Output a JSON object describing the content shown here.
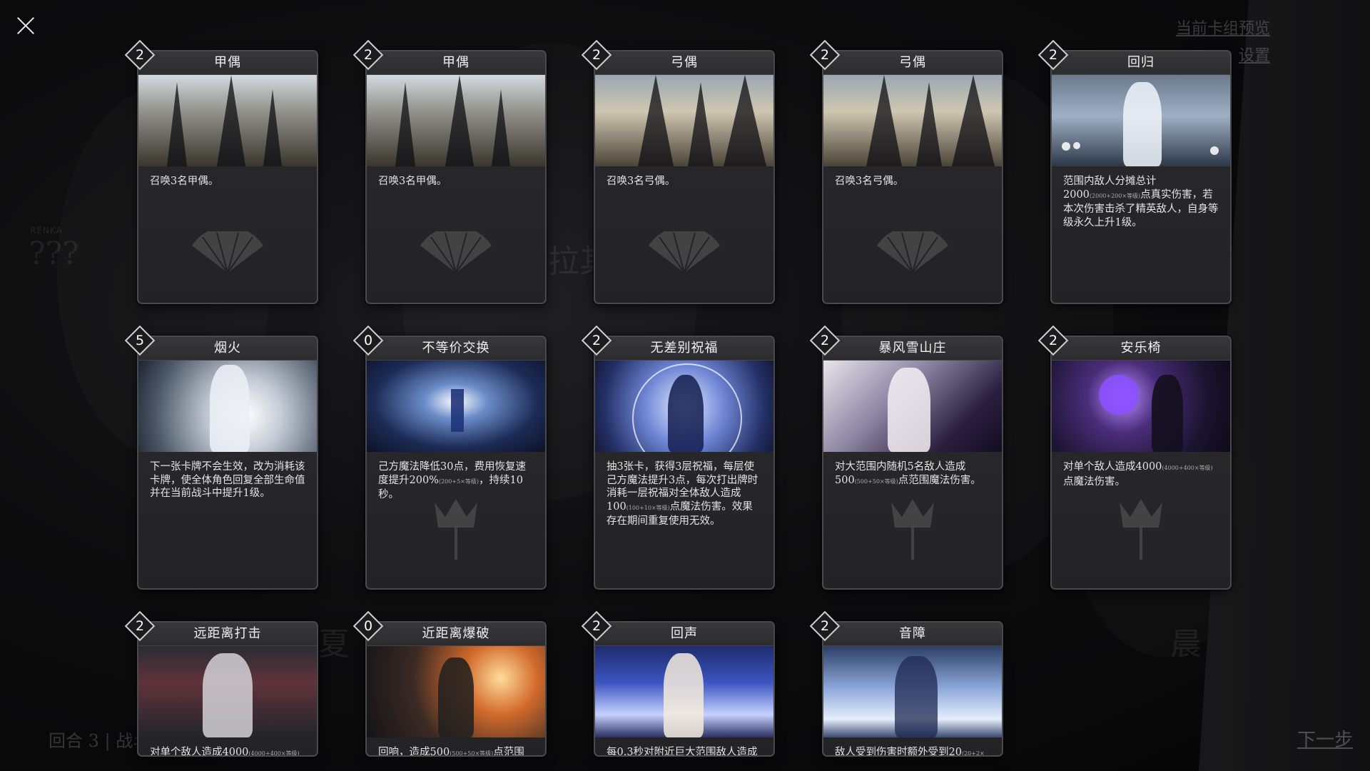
{
  "header": {
    "preview_link": "当前卡组预览",
    "settings_link": "设置"
  },
  "background": {
    "name_left": "???",
    "tag_renka": "RENKA",
    "name_center": "拉其",
    "name_summer": "夏",
    "name_morning": "晨"
  },
  "footer": {
    "round_info": "回合 3 | 战斗",
    "next_step": "下一步"
  },
  "cards": [
    {
      "cost": "2",
      "title": "甲偶",
      "desc": "召唤3名甲偶。"
    },
    {
      "cost": "2",
      "title": "甲偶",
      "desc": "召唤3名甲偶。"
    },
    {
      "cost": "2",
      "title": "弓偶",
      "desc": "召唤3名弓偶。"
    },
    {
      "cost": "2",
      "title": "弓偶",
      "desc": "召唤3名弓偶。"
    },
    {
      "cost": "2",
      "title": "回归",
      "desc_a": "范围内敌人分摊总计2000",
      "desc_small": "(2000+200×等级)",
      "desc_b": "点真实伤害，若本次伤害击杀了精英敌人，自身等级永久上升1级。"
    },
    {
      "cost": "5",
      "title": "烟火",
      "desc": "下一张卡牌不会生效，改为消耗该卡牌，使全体角色回复全部生命值并在当前战斗中提升1级。"
    },
    {
      "cost": "0",
      "title": "不等价交换",
      "desc_a": "己方魔法降低30点，费用恢复速度提升200%",
      "desc_small": "(200+5×等级)",
      "desc_b": "，持续10秒。"
    },
    {
      "cost": "2",
      "title": "无差别祝福",
      "desc_a": "抽3张卡，获得3层祝福，每层使己方魔法提升3点，每次打出牌时消耗一层祝福对全体敌人造成100",
      "desc_small": "(100+10×等级)",
      "desc_b": "点魔法伤害。效果存在期间重复使用无效。"
    },
    {
      "cost": "2",
      "title": "暴风雪山庄",
      "desc_a": "对大范围内随机5名敌人造成500",
      "desc_small": "(500+50×等级)",
      "desc_b": "点范围魔法伤害。"
    },
    {
      "cost": "2",
      "title": "安乐椅",
      "desc_a": "对单个敌人造成4000",
      "desc_small": "(4000+400×等级)",
      "desc_b": "点魔法伤害。"
    },
    {
      "cost": "2",
      "title": "远距离打击",
      "desc_a": "对单个敌人造成4000",
      "desc_small": "(4000+400×等级)",
      "desc_b": ""
    },
    {
      "cost": "0",
      "title": "近距离爆破",
      "desc_a": "回响，造成500",
      "desc_small": "(500+50×等级)",
      "desc_b": "点范围"
    },
    {
      "cost": "2",
      "title": "回声",
      "desc": "每0.3秒对附近巨大范围敌人造成"
    },
    {
      "cost": "2",
      "title": "音障",
      "desc_a": "敌人受到伤害时额外受到20",
      "desc_small": "(20+2×",
      "desc_b": ""
    }
  ],
  "colors": {
    "card_border": "#4a4a4e",
    "card_bg": "#2b2b2d",
    "cost_border": "#cfcfcf"
  }
}
